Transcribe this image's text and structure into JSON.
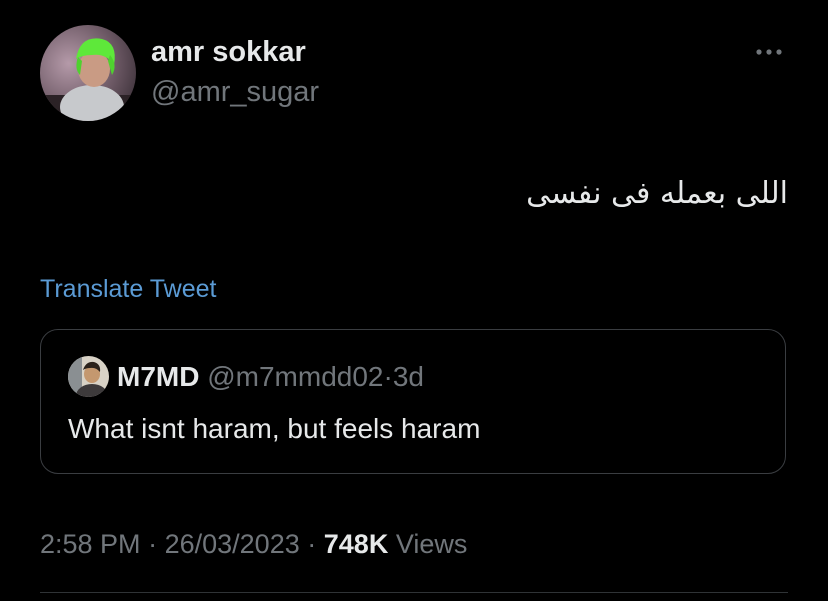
{
  "tweet": {
    "author": {
      "display_name": "amr sokkar",
      "handle": "@amr_sugar",
      "avatar_icon": "profile-photo-green-hair"
    },
    "more_icon": "more-horizontal-icon",
    "text": "اللى بعمله فى نفسى",
    "translate_label": "Translate Tweet",
    "quoted": {
      "display_name": "M7MD",
      "handle": "@m7mmdd02",
      "separator": "·",
      "age": "3d",
      "text": "What isnt haram, but feels haram",
      "avatar_icon": "profile-photo"
    },
    "meta": {
      "time": "2:58 PM",
      "sep1": "·",
      "date": "26/03/2023",
      "sep2": "·",
      "views_count": "748K",
      "views_label": "Views"
    }
  },
  "colors": {
    "background": "#000000",
    "primary_text": "#e7e9ea",
    "secondary_text": "#71767b",
    "link": "#5b9bd5",
    "border": "#3a3d41"
  }
}
